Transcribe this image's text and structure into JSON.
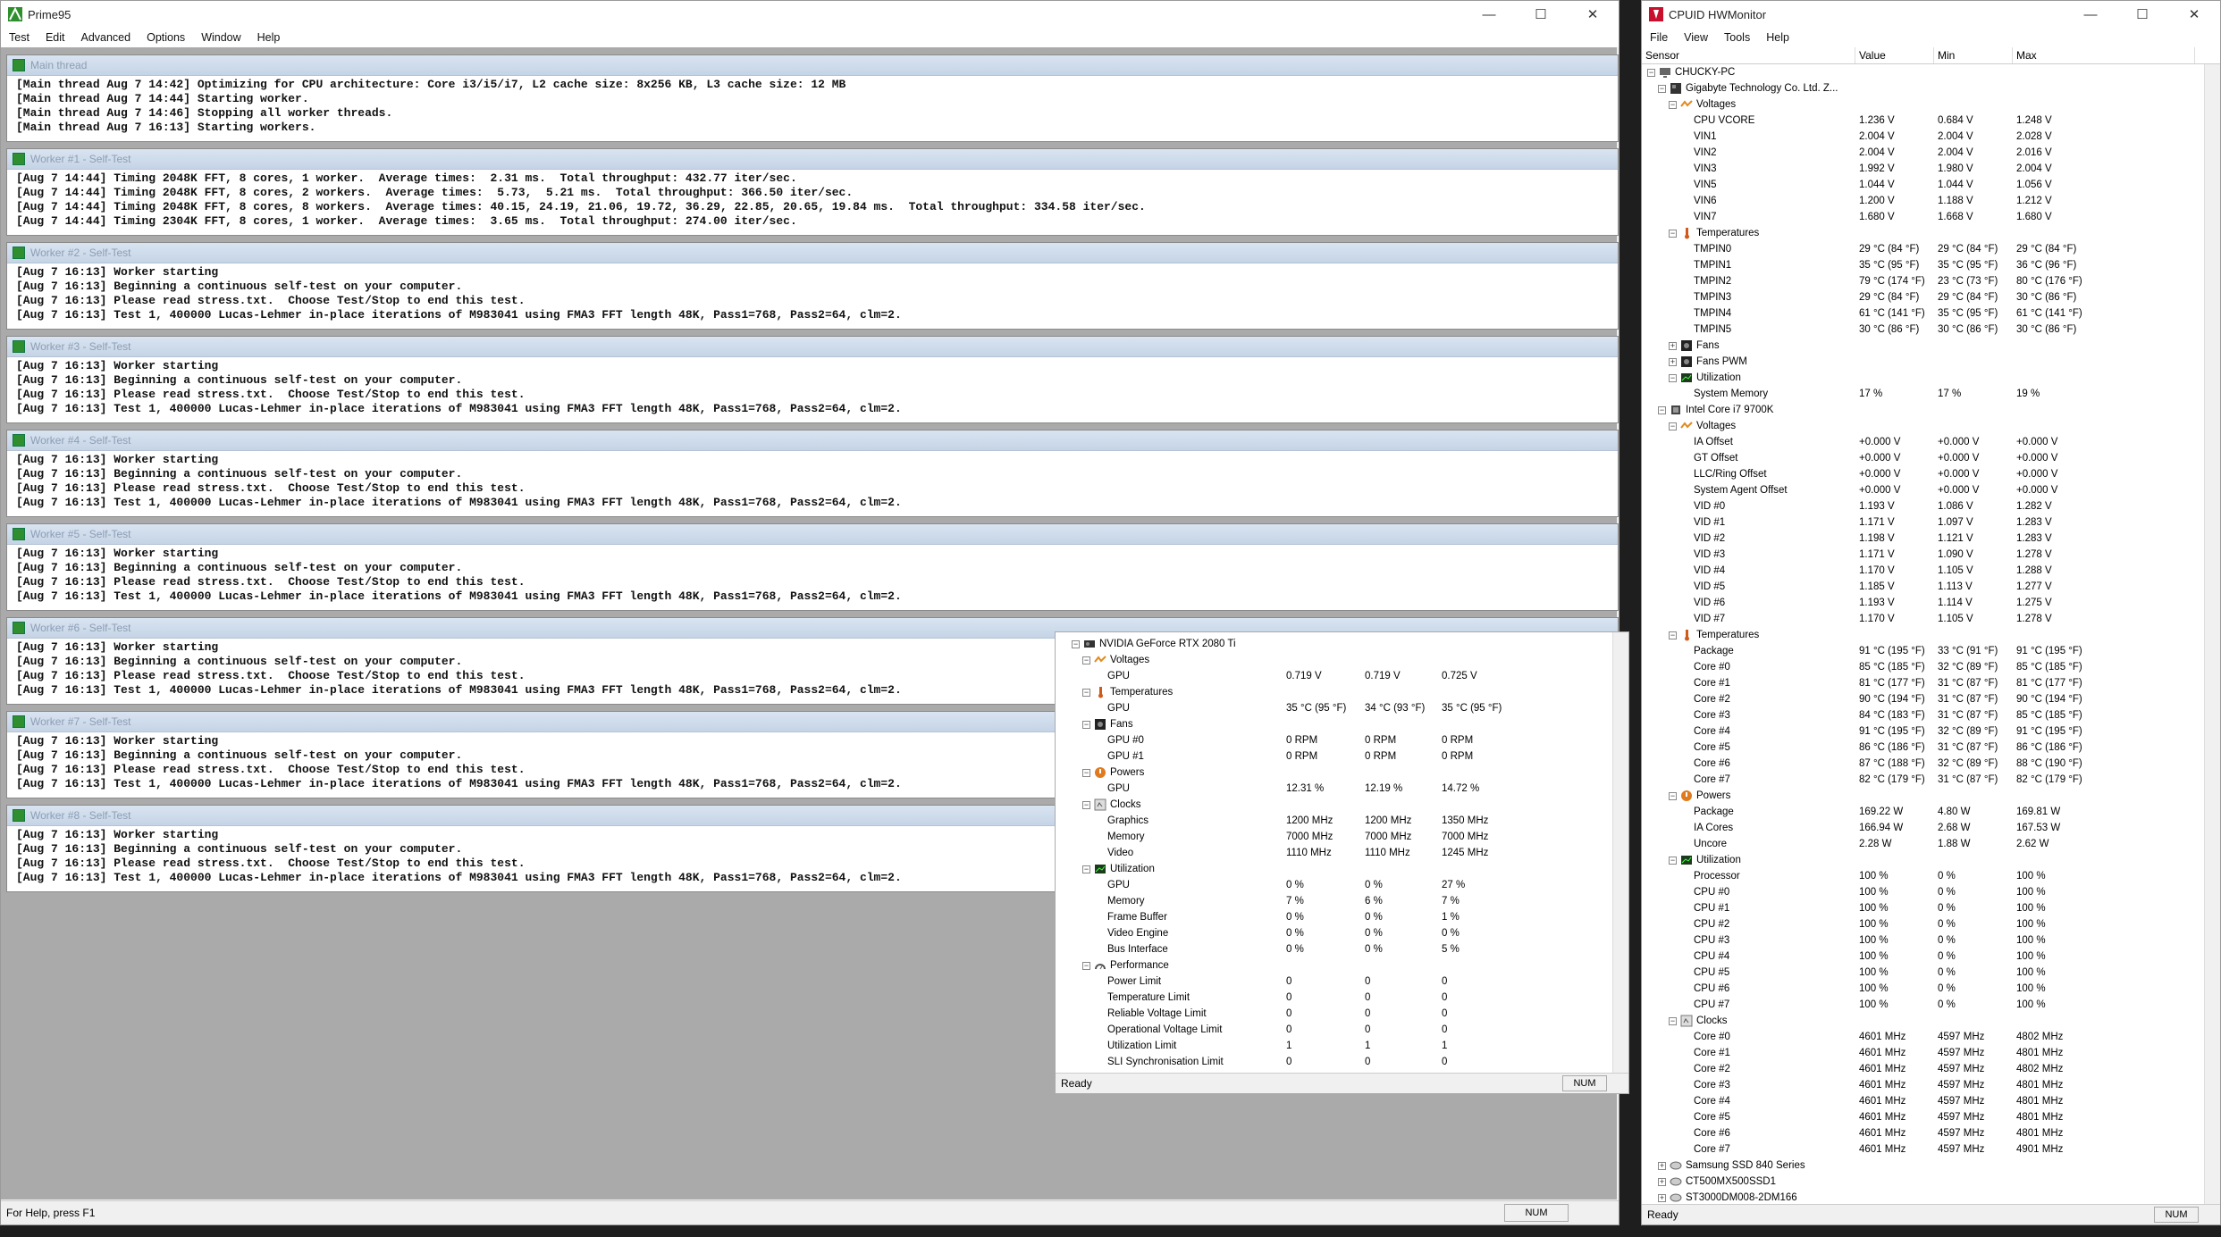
{
  "prime": {
    "title": "Prime95",
    "menu": [
      "Test",
      "Edit",
      "Advanced",
      "Options",
      "Window",
      "Help"
    ],
    "status": "For Help, press F1",
    "num": "NUM",
    "threads": [
      {
        "title": "Main thread",
        "lines": [
          "[Main thread Aug 7 14:42] Optimizing for CPU architecture: Core i3/i5/i7, L2 cache size: 8x256 KB, L3 cache size: 12 MB",
          "[Main thread Aug 7 14:44] Starting worker.",
          "[Main thread Aug 7 14:46] Stopping all worker threads.",
          "[Main thread Aug 7 16:13] Starting workers."
        ]
      },
      {
        "title": "Worker #1 - Self-Test",
        "lines": [
          "[Aug 7 14:44] Timing 2048K FFT, 8 cores, 1 worker.  Average times:  2.31 ms.  Total throughput: 432.77 iter/sec.",
          "[Aug 7 14:44] Timing 2048K FFT, 8 cores, 2 workers.  Average times:  5.73,  5.21 ms.  Total throughput: 366.50 iter/sec.",
          "[Aug 7 14:44] Timing 2048K FFT, 8 cores, 8 workers.  Average times: 40.15, 24.19, 21.06, 19.72, 36.29, 22.85, 20.65, 19.84 ms.  Total throughput: 334.58 iter/sec.",
          "[Aug 7 14:44] Timing 2304K FFT, 8 cores, 1 worker.  Average times:  3.65 ms.  Total throughput: 274.00 iter/sec."
        ]
      },
      {
        "title": "Worker #2 - Self-Test",
        "lines": [
          "[Aug 7 16:13] Worker starting",
          "[Aug 7 16:13] Beginning a continuous self-test on your computer.",
          "[Aug 7 16:13] Please read stress.txt.  Choose Test/Stop to end this test.",
          "[Aug 7 16:13] Test 1, 400000 Lucas-Lehmer in-place iterations of M983041 using FMA3 FFT length 48K, Pass1=768, Pass2=64, clm=2."
        ]
      },
      {
        "title": "Worker #3 - Self-Test",
        "lines": [
          "[Aug 7 16:13] Worker starting",
          "[Aug 7 16:13] Beginning a continuous self-test on your computer.",
          "[Aug 7 16:13] Please read stress.txt.  Choose Test/Stop to end this test.",
          "[Aug 7 16:13] Test 1, 400000 Lucas-Lehmer in-place iterations of M983041 using FMA3 FFT length 48K, Pass1=768, Pass2=64, clm=2."
        ]
      },
      {
        "title": "Worker #4 - Self-Test",
        "lines": [
          "[Aug 7 16:13] Worker starting",
          "[Aug 7 16:13] Beginning a continuous self-test on your computer.",
          "[Aug 7 16:13] Please read stress.txt.  Choose Test/Stop to end this test.",
          "[Aug 7 16:13] Test 1, 400000 Lucas-Lehmer in-place iterations of M983041 using FMA3 FFT length 48K, Pass1=768, Pass2=64, clm=2."
        ]
      },
      {
        "title": "Worker #5 - Self-Test",
        "lines": [
          "[Aug 7 16:13] Worker starting",
          "[Aug 7 16:13] Beginning a continuous self-test on your computer.",
          "[Aug 7 16:13] Please read stress.txt.  Choose Test/Stop to end this test.",
          "[Aug 7 16:13] Test 1, 400000 Lucas-Lehmer in-place iterations of M983041 using FMA3 FFT length 48K, Pass1=768, Pass2=64, clm=2."
        ]
      },
      {
        "title": "Worker #6 - Self-Test",
        "lines": [
          "[Aug 7 16:13] Worker starting",
          "[Aug 7 16:13] Beginning a continuous self-test on your computer.",
          "[Aug 7 16:13] Please read stress.txt.  Choose Test/Stop to end this test.",
          "[Aug 7 16:13] Test 1, 400000 Lucas-Lehmer in-place iterations of M983041 using FMA3 FFT length 48K, Pass1=768, Pass2=64, clm=2."
        ]
      },
      {
        "title": "Worker #7 - Self-Test",
        "lines": [
          "[Aug 7 16:13] Worker starting",
          "[Aug 7 16:13] Beginning a continuous self-test on your computer.",
          "[Aug 7 16:13] Please read stress.txt.  Choose Test/Stop to end this test.",
          "[Aug 7 16:13] Test 1, 400000 Lucas-Lehmer in-place iterations of M983041 using FMA3 FFT length 48K, Pass1=768, Pass2=64, clm=2."
        ]
      },
      {
        "title": "Worker #8 - Self-Test",
        "lines": [
          "[Aug 7 16:13] Worker starting",
          "[Aug 7 16:13] Beginning a continuous self-test on your computer.",
          "[Aug 7 16:13] Please read stress.txt.  Choose Test/Stop to end this test.",
          "[Aug 7 16:13] Test 1, 400000 Lucas-Lehmer in-place iterations of M983041 using FMA3 FFT length 48K, Pass1=768, Pass2=64, clm=2."
        ]
      }
    ]
  },
  "hwm": {
    "title": "CPUID HWMonitor",
    "menu": [
      "File",
      "View",
      "Tools",
      "Help"
    ],
    "columns": [
      "Sensor",
      "Value",
      "Min",
      "Max"
    ],
    "status": "Ready",
    "num": "NUM",
    "rows": [
      {
        "d": 0,
        "t": "m",
        "icon": "computer",
        "label": "CHUCKY-PC"
      },
      {
        "d": 1,
        "t": "m",
        "icon": "board",
        "label": "Gigabyte Technology Co. Ltd. Z..."
      },
      {
        "d": 2,
        "t": "m",
        "icon": "voltage",
        "label": "Voltages"
      },
      {
        "d": 3,
        "label": "CPU VCORE",
        "v": "1.236 V",
        "mn": "0.684 V",
        "mx": "1.248 V"
      },
      {
        "d": 3,
        "label": "VIN1",
        "v": "2.004 V",
        "mn": "2.004 V",
        "mx": "2.028 V"
      },
      {
        "d": 3,
        "label": "VIN2",
        "v": "2.004 V",
        "mn": "2.004 V",
        "mx": "2.016 V"
      },
      {
        "d": 3,
        "label": "VIN3",
        "v": "1.992 V",
        "mn": "1.980 V",
        "mx": "2.004 V"
      },
      {
        "d": 3,
        "label": "VIN5",
        "v": "1.044 V",
        "mn": "1.044 V",
        "mx": "1.056 V"
      },
      {
        "d": 3,
        "label": "VIN6",
        "v": "1.200 V",
        "mn": "1.188 V",
        "mx": "1.212 V"
      },
      {
        "d": 3,
        "label": "VIN7",
        "v": "1.680 V",
        "mn": "1.668 V",
        "mx": "1.680 V"
      },
      {
        "d": 2,
        "t": "m",
        "icon": "temp",
        "label": "Temperatures"
      },
      {
        "d": 3,
        "label": "TMPIN0",
        "v": "29 °C  (84 °F)",
        "mn": "29 °C  (84 °F)",
        "mx": "29 °C  (84 °F)"
      },
      {
        "d": 3,
        "label": "TMPIN1",
        "v": "35 °C  (95 °F)",
        "mn": "35 °C  (95 °F)",
        "mx": "36 °C  (96 °F)"
      },
      {
        "d": 3,
        "label": "TMPIN2",
        "v": "79 °C  (174 °F)",
        "mn": "23 °C  (73 °F)",
        "mx": "80 °C  (176 °F)"
      },
      {
        "d": 3,
        "label": "TMPIN3",
        "v": "29 °C  (84 °F)",
        "mn": "29 °C  (84 °F)",
        "mx": "30 °C  (86 °F)"
      },
      {
        "d": 3,
        "label": "TMPIN4",
        "v": "61 °C  (141 °F)",
        "mn": "35 °C  (95 °F)",
        "mx": "61 °C  (141 °F)"
      },
      {
        "d": 3,
        "label": "TMPIN5",
        "v": "30 °C  (86 °F)",
        "mn": "30 °C  (86 °F)",
        "mx": "30 °C  (86 °F)"
      },
      {
        "d": 2,
        "t": "p",
        "icon": "fan",
        "label": "Fans"
      },
      {
        "d": 2,
        "t": "p",
        "icon": "fan",
        "label": "Fans PWM"
      },
      {
        "d": 2,
        "t": "m",
        "icon": "util",
        "label": "Utilization"
      },
      {
        "d": 3,
        "label": "System Memory",
        "v": "17 %",
        "mn": "17 %",
        "mx": "19 %"
      },
      {
        "d": 1,
        "t": "m",
        "icon": "chip",
        "label": "Intel Core i7 9700K"
      },
      {
        "d": 2,
        "t": "m",
        "icon": "voltage",
        "label": "Voltages"
      },
      {
        "d": 3,
        "label": "IA Offset",
        "v": "+0.000 V",
        "mn": "+0.000 V",
        "mx": "+0.000 V"
      },
      {
        "d": 3,
        "label": "GT Offset",
        "v": "+0.000 V",
        "mn": "+0.000 V",
        "mx": "+0.000 V"
      },
      {
        "d": 3,
        "label": "LLC/Ring Offset",
        "v": "+0.000 V",
        "mn": "+0.000 V",
        "mx": "+0.000 V"
      },
      {
        "d": 3,
        "label": "System Agent Offset",
        "v": "+0.000 V",
        "mn": "+0.000 V",
        "mx": "+0.000 V"
      },
      {
        "d": 3,
        "label": "VID #0",
        "v": "1.193 V",
        "mn": "1.086 V",
        "mx": "1.282 V"
      },
      {
        "d": 3,
        "label": "VID #1",
        "v": "1.171 V",
        "mn": "1.097 V",
        "mx": "1.283 V"
      },
      {
        "d": 3,
        "label": "VID #2",
        "v": "1.198 V",
        "mn": "1.121 V",
        "mx": "1.283 V"
      },
      {
        "d": 3,
        "label": "VID #3",
        "v": "1.171 V",
        "mn": "1.090 V",
        "mx": "1.278 V"
      },
      {
        "d": 3,
        "label": "VID #4",
        "v": "1.170 V",
        "mn": "1.105 V",
        "mx": "1.288 V"
      },
      {
        "d": 3,
        "label": "VID #5",
        "v": "1.185 V",
        "mn": "1.113 V",
        "mx": "1.277 V"
      },
      {
        "d": 3,
        "label": "VID #6",
        "v": "1.193 V",
        "mn": "1.114 V",
        "mx": "1.275 V"
      },
      {
        "d": 3,
        "label": "VID #7",
        "v": "1.170 V",
        "mn": "1.105 V",
        "mx": "1.278 V"
      },
      {
        "d": 2,
        "t": "m",
        "icon": "temp",
        "label": "Temperatures"
      },
      {
        "d": 3,
        "label": "Package",
        "v": "91 °C  (195 °F)",
        "mn": "33 °C  (91 °F)",
        "mx": "91 °C  (195 °F)"
      },
      {
        "d": 3,
        "label": "Core #0",
        "v": "85 °C  (185 °F)",
        "mn": "32 °C  (89 °F)",
        "mx": "85 °C  (185 °F)"
      },
      {
        "d": 3,
        "label": "Core #1",
        "v": "81 °C  (177 °F)",
        "mn": "31 °C  (87 °F)",
        "mx": "81 °C  (177 °F)"
      },
      {
        "d": 3,
        "label": "Core #2",
        "v": "90 °C  (194 °F)",
        "mn": "31 °C  (87 °F)",
        "mx": "90 °C  (194 °F)"
      },
      {
        "d": 3,
        "label": "Core #3",
        "v": "84 °C  (183 °F)",
        "mn": "31 °C  (87 °F)",
        "mx": "85 °C  (185 °F)"
      },
      {
        "d": 3,
        "label": "Core #4",
        "v": "91 °C  (195 °F)",
        "mn": "32 °C  (89 °F)",
        "mx": "91 °C  (195 °F)"
      },
      {
        "d": 3,
        "label": "Core #5",
        "v": "86 °C  (186 °F)",
        "mn": "31 °C  (87 °F)",
        "mx": "86 °C  (186 °F)"
      },
      {
        "d": 3,
        "label": "Core #6",
        "v": "87 °C  (188 °F)",
        "mn": "32 °C  (89 °F)",
        "mx": "88 °C  (190 °F)"
      },
      {
        "d": 3,
        "label": "Core #7",
        "v": "82 °C  (179 °F)",
        "mn": "31 °C  (87 °F)",
        "mx": "82 °C  (179 °F)"
      },
      {
        "d": 2,
        "t": "m",
        "icon": "power",
        "label": "Powers"
      },
      {
        "d": 3,
        "label": "Package",
        "v": "169.22 W",
        "mn": "4.80 W",
        "mx": "169.81 W"
      },
      {
        "d": 3,
        "label": "IA Cores",
        "v": "166.94 W",
        "mn": "2.68 W",
        "mx": "167.53 W"
      },
      {
        "d": 3,
        "label": "Uncore",
        "v": "2.28 W",
        "mn": "1.88 W",
        "mx": "2.62 W"
      },
      {
        "d": 2,
        "t": "m",
        "icon": "util",
        "label": "Utilization"
      },
      {
        "d": 3,
        "label": "Processor",
        "v": "100 %",
        "mn": "0 %",
        "mx": "100 %"
      },
      {
        "d": 3,
        "label": "CPU #0",
        "v": "100 %",
        "mn": "0 %",
        "mx": "100 %"
      },
      {
        "d": 3,
        "label": "CPU #1",
        "v": "100 %",
        "mn": "0 %",
        "mx": "100 %"
      },
      {
        "d": 3,
        "label": "CPU #2",
        "v": "100 %",
        "mn": "0 %",
        "mx": "100 %"
      },
      {
        "d": 3,
        "label": "CPU #3",
        "v": "100 %",
        "mn": "0 %",
        "mx": "100 %"
      },
      {
        "d": 3,
        "label": "CPU #4",
        "v": "100 %",
        "mn": "0 %",
        "mx": "100 %"
      },
      {
        "d": 3,
        "label": "CPU #5",
        "v": "100 %",
        "mn": "0 %",
        "mx": "100 %"
      },
      {
        "d": 3,
        "label": "CPU #6",
        "v": "100 %",
        "mn": "0 %",
        "mx": "100 %"
      },
      {
        "d": 3,
        "label": "CPU #7",
        "v": "100 %",
        "mn": "0 %",
        "mx": "100 %"
      },
      {
        "d": 2,
        "t": "m",
        "icon": "clock",
        "label": "Clocks"
      },
      {
        "d": 3,
        "label": "Core #0",
        "v": "4601 MHz",
        "mn": "4597 MHz",
        "mx": "4802 MHz"
      },
      {
        "d": 3,
        "label": "Core #1",
        "v": "4601 MHz",
        "mn": "4597 MHz",
        "mx": "4801 MHz"
      },
      {
        "d": 3,
        "label": "Core #2",
        "v": "4601 MHz",
        "mn": "4597 MHz",
        "mx": "4802 MHz"
      },
      {
        "d": 3,
        "label": "Core #3",
        "v": "4601 MHz",
        "mn": "4597 MHz",
        "mx": "4801 MHz"
      },
      {
        "d": 3,
        "label": "Core #4",
        "v": "4601 MHz",
        "mn": "4597 MHz",
        "mx": "4801 MHz"
      },
      {
        "d": 3,
        "label": "Core #5",
        "v": "4601 MHz",
        "mn": "4597 MHz",
        "mx": "4801 MHz"
      },
      {
        "d": 3,
        "label": "Core #6",
        "v": "4601 MHz",
        "mn": "4597 MHz",
        "mx": "4801 MHz"
      },
      {
        "d": 3,
        "label": "Core #7",
        "v": "4601 MHz",
        "mn": "4597 MHz",
        "mx": "4901 MHz"
      },
      {
        "d": 1,
        "t": "p",
        "icon": "disk",
        "label": "Samsung SSD 840 Series"
      },
      {
        "d": 1,
        "t": "p",
        "icon": "disk",
        "label": "CT500MX500SSD1"
      },
      {
        "d": 1,
        "t": "p",
        "icon": "disk",
        "label": "ST3000DM008-2DM166"
      }
    ]
  },
  "gpu": {
    "status": "Ready",
    "num": "NUM",
    "rows": [
      {
        "d": 1,
        "t": "m",
        "icon": "gpu",
        "label": "NVIDIA GeForce RTX 2080 Ti"
      },
      {
        "d": 2,
        "t": "m",
        "icon": "voltage",
        "label": "Voltages"
      },
      {
        "d": 3,
        "label": "GPU",
        "v": "0.719 V",
        "mn": "0.719 V",
        "mx": "0.725 V"
      },
      {
        "d": 2,
        "t": "m",
        "icon": "temp",
        "label": "Temperatures"
      },
      {
        "d": 3,
        "label": "GPU",
        "v": "35 °C  (95 °F)",
        "mn": "34 °C  (93 °F)",
        "mx": "35 °C  (95 °F)"
      },
      {
        "d": 2,
        "t": "m",
        "icon": "fan",
        "label": "Fans"
      },
      {
        "d": 3,
        "label": "GPU #0",
        "v": "0 RPM",
        "mn": "0 RPM",
        "mx": "0 RPM"
      },
      {
        "d": 3,
        "label": "GPU #1",
        "v": "0 RPM",
        "mn": "0 RPM",
        "mx": "0 RPM"
      },
      {
        "d": 2,
        "t": "m",
        "icon": "power",
        "label": "Powers"
      },
      {
        "d": 3,
        "label": "GPU",
        "v": "12.31 %",
        "mn": "12.19 %",
        "mx": "14.72 %"
      },
      {
        "d": 2,
        "t": "m",
        "icon": "clock",
        "label": "Clocks"
      },
      {
        "d": 3,
        "label": "Graphics",
        "v": "1200 MHz",
        "mn": "1200 MHz",
        "mx": "1350 MHz"
      },
      {
        "d": 3,
        "label": "Memory",
        "v": "7000 MHz",
        "mn": "7000 MHz",
        "mx": "7000 MHz"
      },
      {
        "d": 3,
        "label": "Video",
        "v": "1110 MHz",
        "mn": "1110 MHz",
        "mx": "1245 MHz"
      },
      {
        "d": 2,
        "t": "m",
        "icon": "util",
        "label": "Utilization"
      },
      {
        "d": 3,
        "label": "GPU",
        "v": "0 %",
        "mn": "0 %",
        "mx": "27 %"
      },
      {
        "d": 3,
        "label": "Memory",
        "v": "7 %",
        "mn": "6 %",
        "mx": "7 %"
      },
      {
        "d": 3,
        "label": "Frame Buffer",
        "v": "0 %",
        "mn": "0 %",
        "mx": "1 %"
      },
      {
        "d": 3,
        "label": "Video Engine",
        "v": "0 %",
        "mn": "0 %",
        "mx": "0 %"
      },
      {
        "d": 3,
        "label": "Bus Interface",
        "v": "0 %",
        "mn": "0 %",
        "mx": "5 %"
      },
      {
        "d": 2,
        "t": "m",
        "icon": "perf",
        "label": "Performance"
      },
      {
        "d": 3,
        "label": "Power Limit",
        "v": "0",
        "mn": "0",
        "mx": "0"
      },
      {
        "d": 3,
        "label": "Temperature Limit",
        "v": "0",
        "mn": "0",
        "mx": "0"
      },
      {
        "d": 3,
        "label": "Reliable Voltage Limit",
        "v": "0",
        "mn": "0",
        "mx": "0"
      },
      {
        "d": 3,
        "label": "Operational Voltage Limit",
        "v": "0",
        "mn": "0",
        "mx": "0"
      },
      {
        "d": 3,
        "label": "Utilization Limit",
        "v": "1",
        "mn": "1",
        "mx": "1"
      },
      {
        "d": 3,
        "label": "SLI Synchronisation Limit",
        "v": "0",
        "mn": "0",
        "mx": "0"
      }
    ]
  },
  "colors": {
    "accent": "#0078d7",
    "green": "#2f8f2f"
  }
}
